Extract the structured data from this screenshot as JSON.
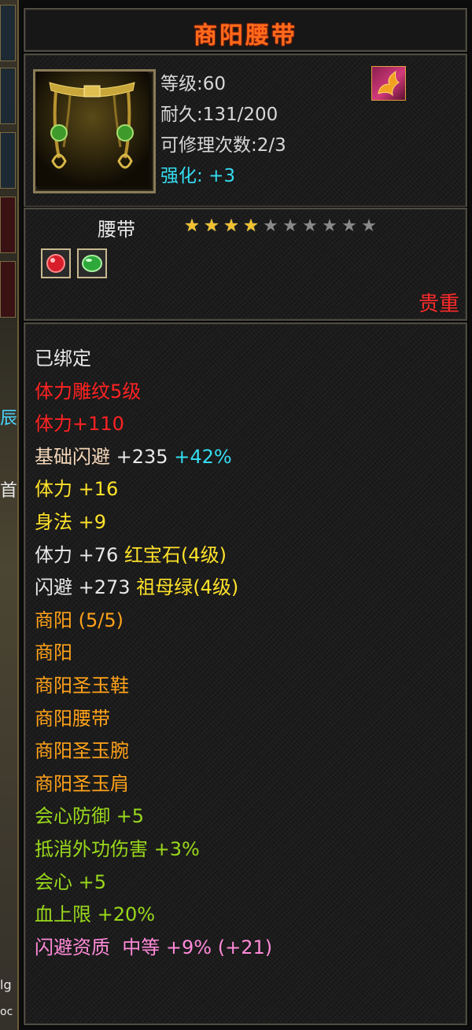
{
  "item": {
    "name": "商阳腰带",
    "level_line": "等级:60",
    "durability_line": "耐久:131/200",
    "repair_line": "可修理次数:2/3",
    "enhance_label": "强化:",
    "enhance_value": "+3"
  },
  "equip": {
    "slot_type": "腰带",
    "stars_filled": 4,
    "stars_total": 10,
    "rarity": "贵重",
    "gem_slots": [
      {
        "name": "ruby-gem-icon",
        "color": "#d81e2a"
      },
      {
        "name": "emerald-gem-icon",
        "color": "#2ea83a"
      }
    ]
  },
  "stats": {
    "bound": "已绑定",
    "engrave": "体力雕纹5级",
    "engrave_bonus": "体力+110",
    "base_dodge": {
      "label": "基础闪避",
      "value": "+235",
      "pct": "+42%"
    },
    "attr1": {
      "label": "体力",
      "value": "+16"
    },
    "attr2": {
      "label": "身法",
      "value": "+9"
    },
    "gem1": {
      "label": "体力",
      "value": "+76",
      "gem": "红宝石(4级)"
    },
    "gem2": {
      "label": "闪避",
      "value": "+273",
      "gem": "祖母绿(4级)"
    },
    "set": {
      "header": "商阳 (5/5)",
      "pieces": [
        "商阳",
        "商阳圣玉鞋",
        "商阳腰带",
        "商阳圣玉腕",
        "商阳圣玉肩"
      ]
    },
    "set_bonuses": [
      {
        "label": "会心防御",
        "value": "+5"
      },
      {
        "label": "抵消外功伤害",
        "value": "+3%"
      },
      {
        "label": "会心",
        "value": "+5"
      },
      {
        "label": "血上限",
        "value": "+20%"
      }
    ],
    "aptitude": {
      "label": "闪避资质",
      "grade": "中等",
      "value": "+9%",
      "extra": "(+21)"
    }
  },
  "side": {
    "glyph_1": "辰",
    "glyph_2": "首",
    "glyph_3": "lg",
    "glyph_4": "oc"
  }
}
